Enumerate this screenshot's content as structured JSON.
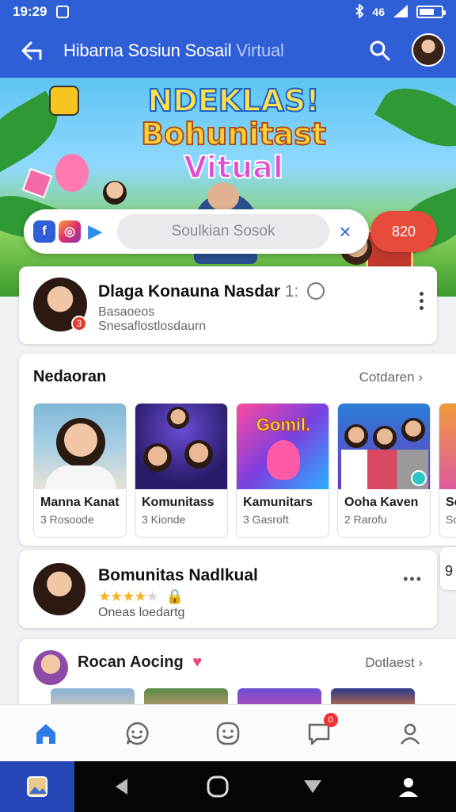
{
  "status_bar": {
    "time": "19:29",
    "signal_label": "46"
  },
  "app_bar": {
    "title_main": "Hibarna Sosiun Sosail",
    "title_dim": "Virtual"
  },
  "banner": {
    "title_line1": "NDEKLAS!",
    "title_line2": "Bohunitast",
    "title_line3": "Vitual",
    "search_placeholder": "Soulkian Sosok",
    "count_label": "820"
  },
  "profile_card": {
    "name": "Dlaga Konauna Nasdar",
    "name_suffix": "1:",
    "badge": "3",
    "line1": "Basaoeos",
    "line2": "Snesaflostlosdaurn"
  },
  "section": {
    "title": "Nedaoran",
    "more_label": "Cotdaren",
    "tiles": [
      {
        "name": "Manna Kanat",
        "sub": "3 Rosoode"
      },
      {
        "name": "Komunitass",
        "sub": "3 Kionde"
      },
      {
        "name": "Kamunitars",
        "sub": "3 Gasroft"
      },
      {
        "name": "Ooha Kaven",
        "sub": "2 Rarofu"
      },
      {
        "name": "Sor",
        "sub": "Sor"
      }
    ],
    "tile3_image_text": "Gomil."
  },
  "featured_card": {
    "name": "Bomunitas Nadlkual",
    "rating": 3.5,
    "sub": "Oneas loedartg"
  },
  "side_peek_label": "9",
  "bottom_section": {
    "title": "Rocan Aocing",
    "more_label": "Dotlaest"
  },
  "nav": [
    {
      "name": "home",
      "active": true
    },
    {
      "name": "community",
      "active": false
    },
    {
      "name": "emoji",
      "active": false
    },
    {
      "name": "messages",
      "active": false,
      "badge": "0"
    },
    {
      "name": "profile",
      "active": false
    }
  ],
  "colors": {
    "primary": "#2f5fd6",
    "accent_red": "#e84a3b",
    "star": "#f5b224"
  }
}
